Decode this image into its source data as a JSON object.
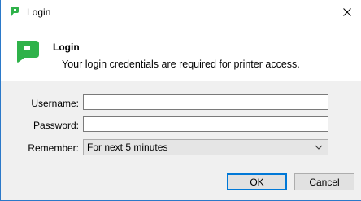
{
  "window": {
    "title": "Login"
  },
  "header": {
    "title": "Login",
    "subtitle": "Your login credentials are required for printer access."
  },
  "form": {
    "username_label": "Username:",
    "username_value": "",
    "password_label": "Password:",
    "password_value": "",
    "remember_label": "Remember:",
    "remember_value": "For next 5 minutes"
  },
  "buttons": {
    "ok": "OK",
    "cancel": "Cancel"
  },
  "colors": {
    "brand": "#2fb24a",
    "accent": "#0078d7",
    "panel": "#f0f0f0"
  },
  "icons": {
    "app": "printerlogic-icon",
    "logo": "printerlogic-logo",
    "close": "close-icon",
    "dropdown": "chevron-down-icon"
  }
}
